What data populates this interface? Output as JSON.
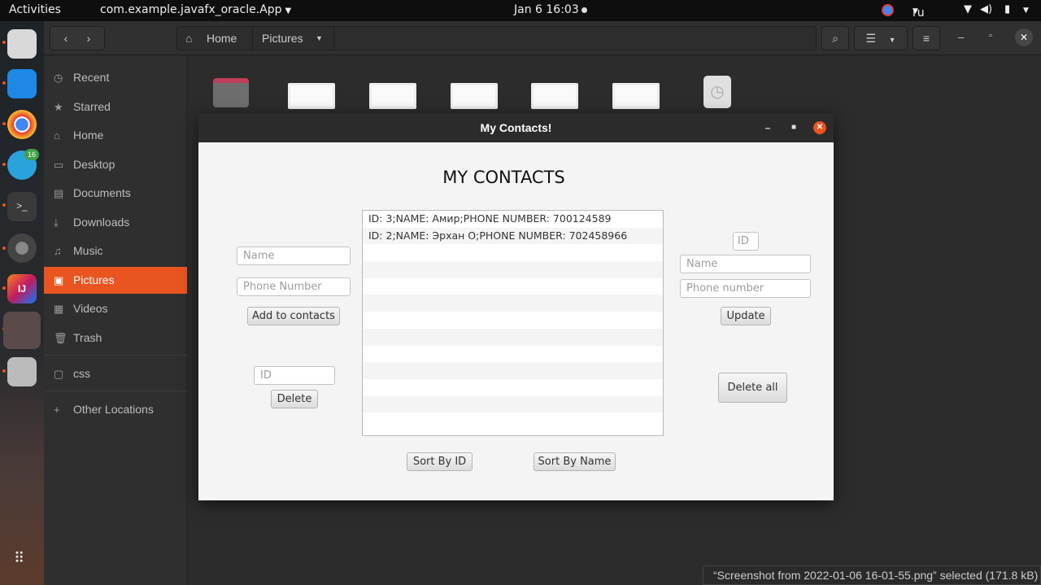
{
  "topbar": {
    "activities": "Activities",
    "app_menu": "com.example.javafx_oracle.App",
    "clock": "Jan 6  16:03",
    "language": "ru"
  },
  "dock": {
    "items": [
      {
        "name": "files",
        "color": "#8a8a8a"
      },
      {
        "name": "vscode",
        "color": "#1e88e5"
      },
      {
        "name": "chrome",
        "color": "#4caf50"
      },
      {
        "name": "telegram",
        "color": "#2aa3dd",
        "badge": "16"
      },
      {
        "name": "terminal",
        "color": "#3a3a3a"
      },
      {
        "name": "settings",
        "color": "#6c6c6c"
      },
      {
        "name": "intellij",
        "color": "#c21a62"
      },
      {
        "name": "running-app",
        "color": "#5a4a4a"
      },
      {
        "name": "image-viewer",
        "color": "#555"
      }
    ]
  },
  "files": {
    "path": [
      "Home",
      "Pictures"
    ],
    "sidebar": [
      {
        "label": "Recent",
        "icon": "clock-icon",
        "glyph": "◷"
      },
      {
        "label": "Starred",
        "icon": "star-icon",
        "glyph": "★"
      },
      {
        "label": "Home",
        "icon": "home-icon",
        "glyph": "⌂"
      },
      {
        "label": "Desktop",
        "icon": "desktop-icon",
        "glyph": "▭"
      },
      {
        "label": "Documents",
        "icon": "document-icon",
        "glyph": "▤"
      },
      {
        "label": "Downloads",
        "icon": "download-icon",
        "glyph": "⤓"
      },
      {
        "label": "Music",
        "icon": "music-icon",
        "glyph": "♫"
      },
      {
        "label": "Pictures",
        "icon": "picture-icon",
        "glyph": "▣",
        "active": true
      },
      {
        "label": "Videos",
        "icon": "video-icon",
        "glyph": "▦"
      },
      {
        "label": "Trash",
        "icon": "trash-icon",
        "glyph": "🗑"
      },
      {
        "label": "css",
        "icon": "folder-icon",
        "glyph": "▢"
      },
      {
        "label": "Other Locations",
        "icon": "plus-icon",
        "glyph": "+"
      }
    ],
    "status": "“Screenshot from 2022-01-06 16-01-55.png” selected  (171.8 kB)"
  },
  "dialog": {
    "title": "My Contacts!",
    "heading": "MY CONTACTS",
    "left": {
      "name_placeholder": "Name",
      "phone_placeholder": "Phone Number",
      "add_label": "Add to contacts",
      "id_placeholder": "ID",
      "delete_label": "Delete"
    },
    "right": {
      "id_placeholder": "ID",
      "name_placeholder": "Name",
      "phone_placeholder": "Phone number",
      "update_label": "Update",
      "delete_all_label": "Delete all"
    },
    "contacts": [
      "ID: 3;NAME: Амир;PHONE NUMBER: 700124589",
      "ID: 2;NAME: Эрхан О;PHONE NUMBER: 702458966",
      "",
      "",
      "",
      "",
      "",
      "",
      "",
      "",
      "",
      "",
      ""
    ],
    "sort_id_label": "Sort By ID",
    "sort_name_label": "Sort By Name"
  }
}
